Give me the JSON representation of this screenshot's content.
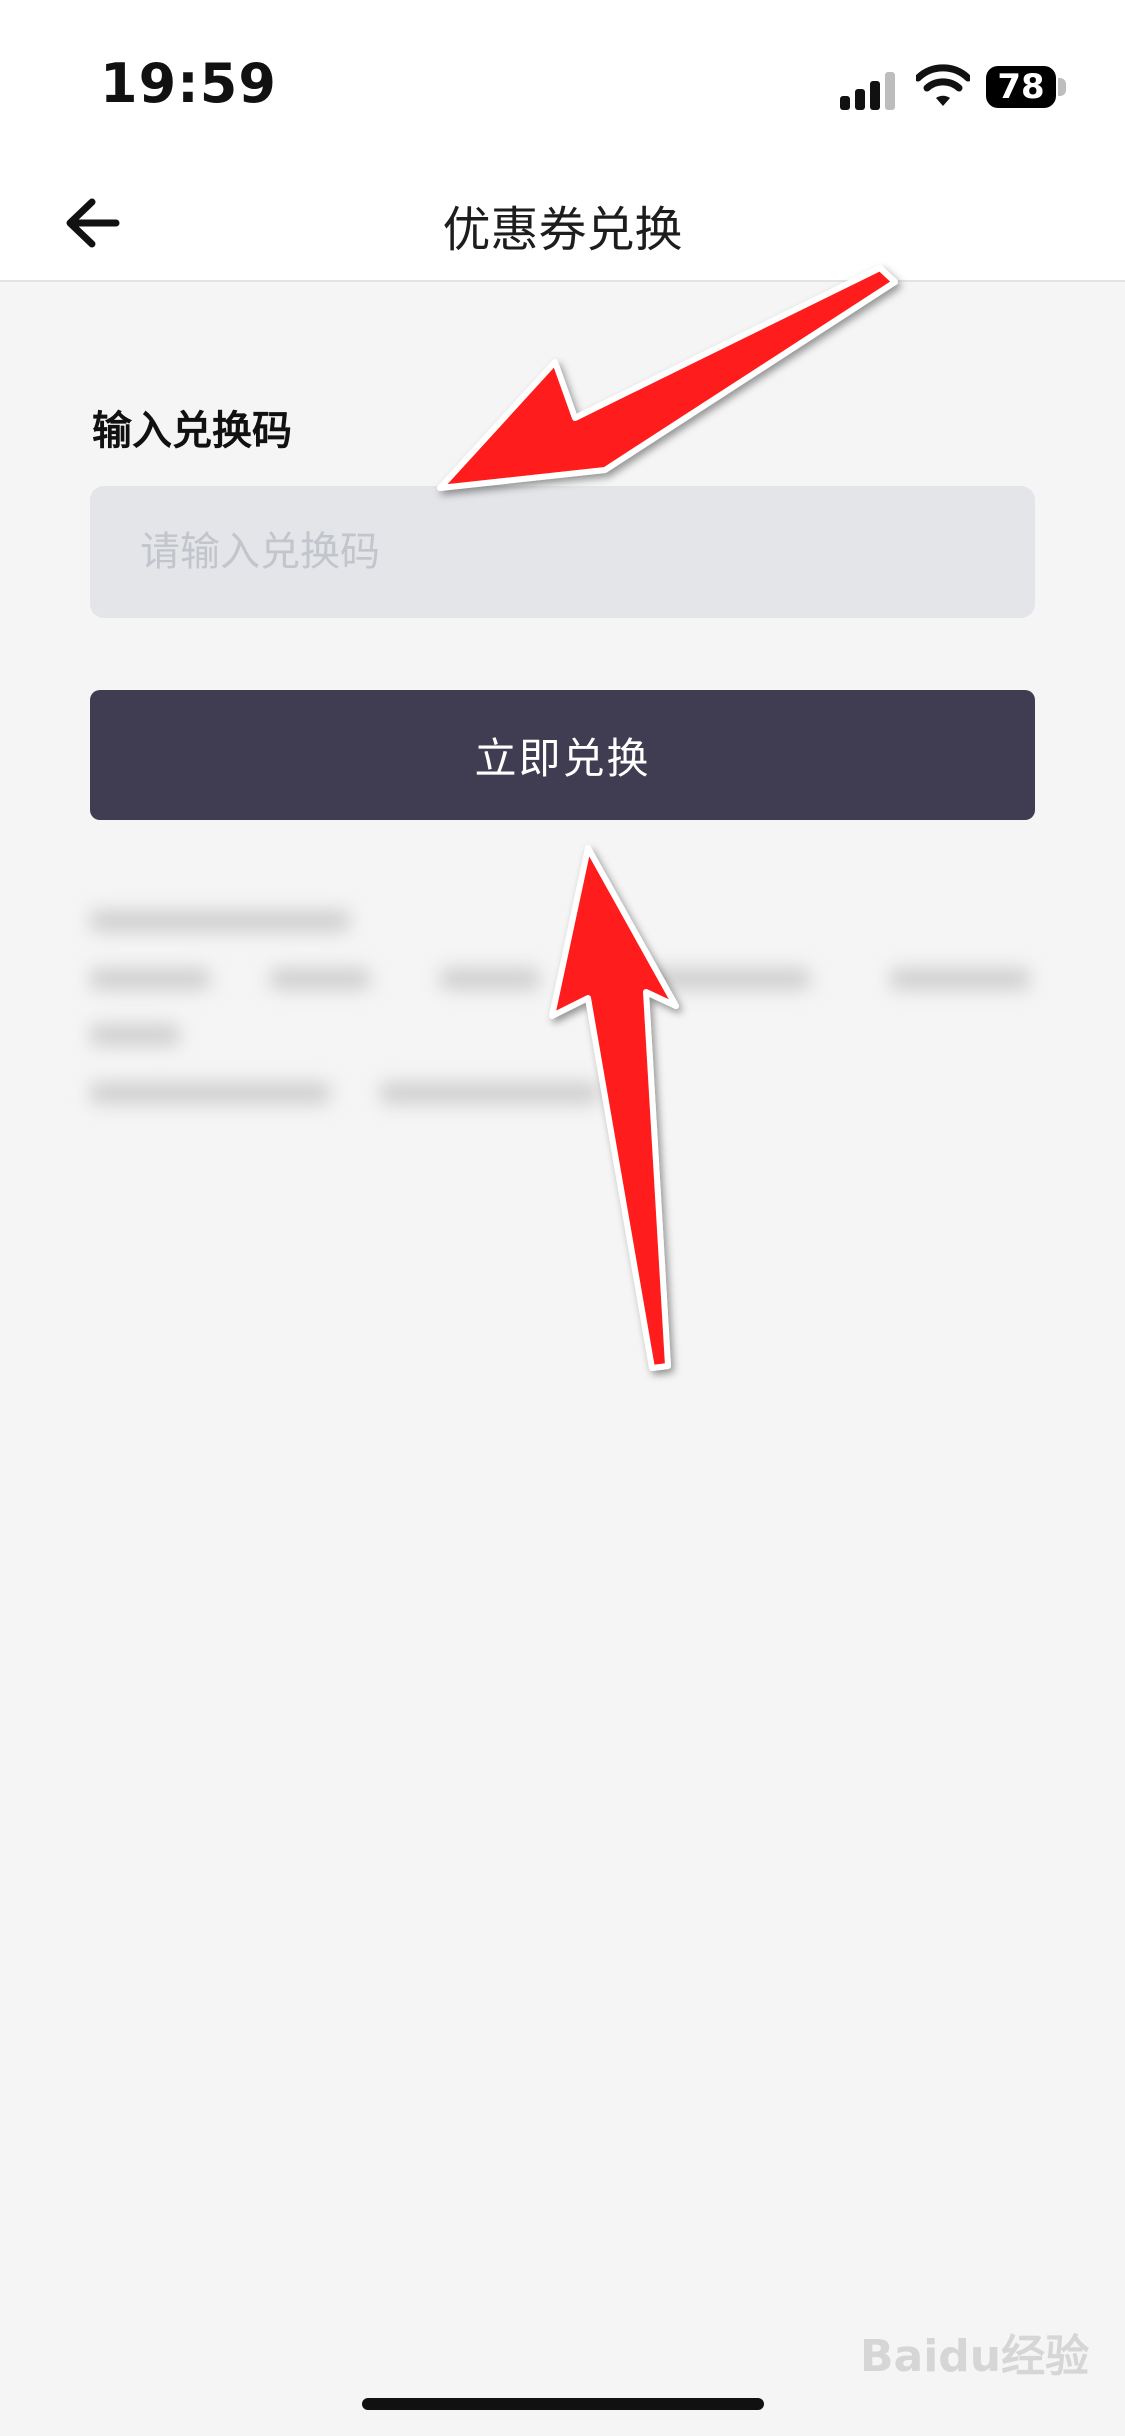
{
  "status_bar": {
    "time": "19:59",
    "battery": "78"
  },
  "header": {
    "title": "优惠券兑换"
  },
  "form": {
    "label": "输入兑换码",
    "input_placeholder": "请输入兑换码",
    "input_value": "",
    "submit_label": "立即兑换"
  },
  "watermark": "Baidu经验",
  "colors": {
    "button": "#403d52",
    "input_bg": "#e4e5e9",
    "page_bg": "#f5f5f5",
    "arrow": "#ff1b1b"
  },
  "icons": {
    "back": "arrow-left-icon",
    "signal": "cellular-signal-icon",
    "wifi": "wifi-icon",
    "battery": "battery-icon"
  }
}
